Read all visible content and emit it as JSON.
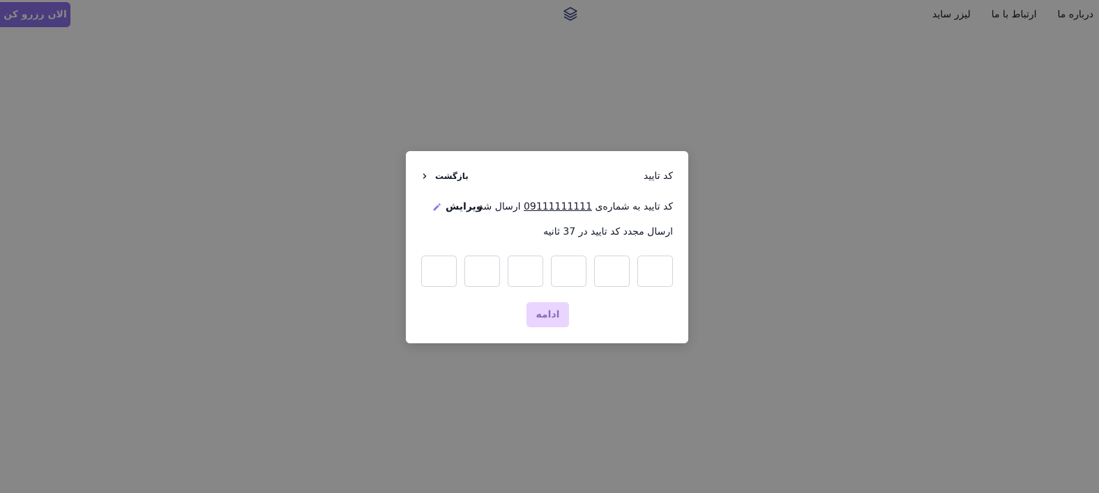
{
  "navbar": {
    "links": [
      {
        "label": "لیزر ساید"
      },
      {
        "label": "ارتباط با ما"
      },
      {
        "label": "درباره ما"
      }
    ],
    "logo_icon": "layers-icon",
    "reserve_label": "الان رزرو کن"
  },
  "modal": {
    "title": "کد تایید",
    "back_label": "بازگشت",
    "sent_prefix": "کد تایید به شماره‌ی ",
    "phone_number": "09111111111",
    "sent_suffix": " ارسال شد",
    "edit_label": "ویرایش",
    "resend_text": "ارسال مجدد کد تایید در 37 ثانیه",
    "otp_digits": [
      "",
      "",
      "",
      "",
      "",
      ""
    ],
    "continue_label": "ادامه"
  },
  "colors": {
    "accent": "#8d72ec",
    "continue_bg": "#e9d5ff",
    "continue_text": "#8b6fb8",
    "overlay": "rgba(0,0,0,0.47)"
  }
}
